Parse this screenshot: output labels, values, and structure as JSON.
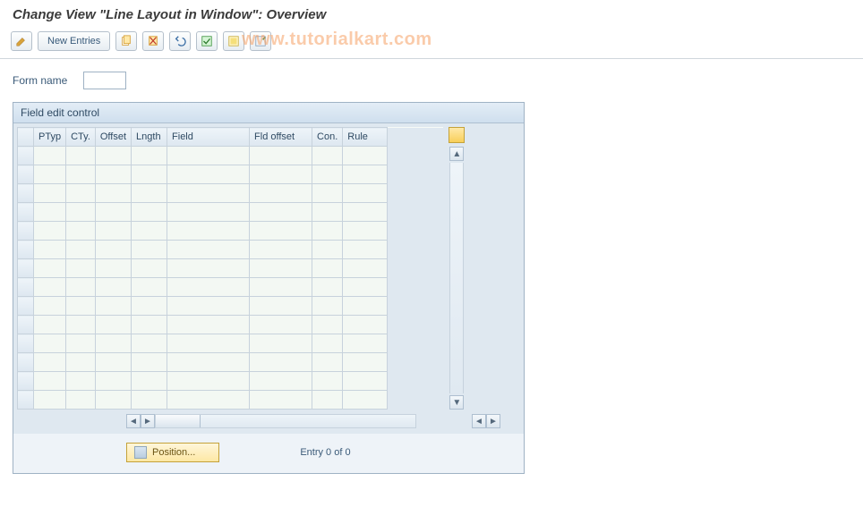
{
  "title": "Change View \"Line Layout in Window\": Overview",
  "watermark": "www.tutorialkart.com",
  "toolbar": {
    "new_entries_label": "New Entries"
  },
  "form": {
    "form_name_label": "Form name",
    "form_name_value": ""
  },
  "panel": {
    "title": "Field edit control",
    "columns": {
      "ptyp": "PTyp",
      "cty": "CTy.",
      "offset": "Offset",
      "length": "Lngth",
      "field": "Field",
      "fld_offset": "Fld offset",
      "con": "Con.",
      "rule": "Rule"
    },
    "rows": [
      {},
      {},
      {},
      {},
      {},
      {},
      {},
      {},
      {},
      {},
      {},
      {},
      {},
      {}
    ]
  },
  "footer": {
    "position_label": "Position...",
    "entry_text": "Entry 0 of 0"
  }
}
